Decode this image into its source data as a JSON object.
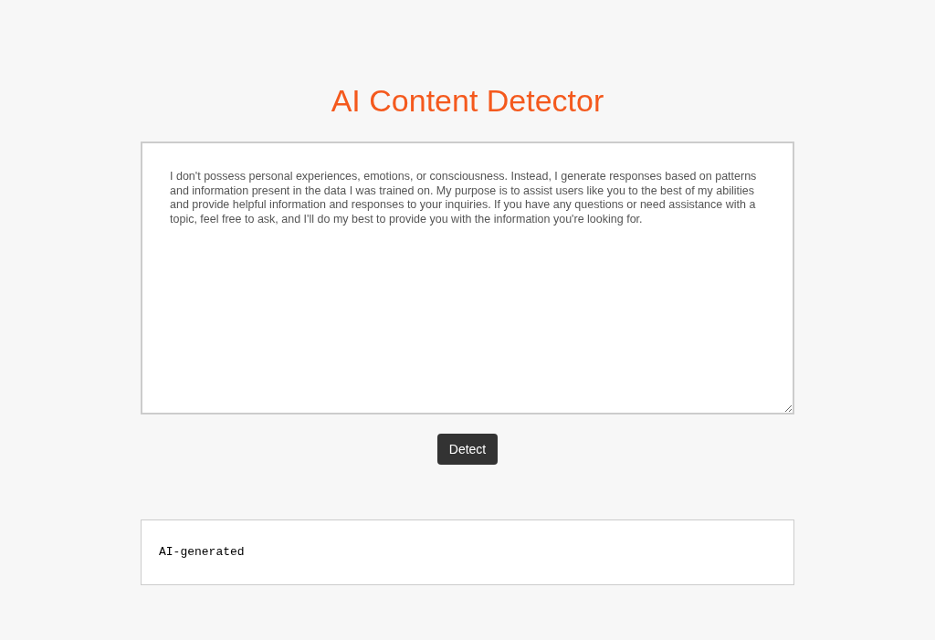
{
  "title": "AI Content Detector",
  "input": {
    "value": "I don't possess personal experiences, emotions, or consciousness. Instead, I generate responses based on patterns and information present in the data I was trained on. My purpose is to assist users like you to the best of my abilities and provide helpful information and responses to your inquiries. If you have any questions or need assistance with a topic, feel free to ask, and I'll do my best to provide you with the information you're looking for."
  },
  "button": "Detect",
  "result": "AI-generated"
}
